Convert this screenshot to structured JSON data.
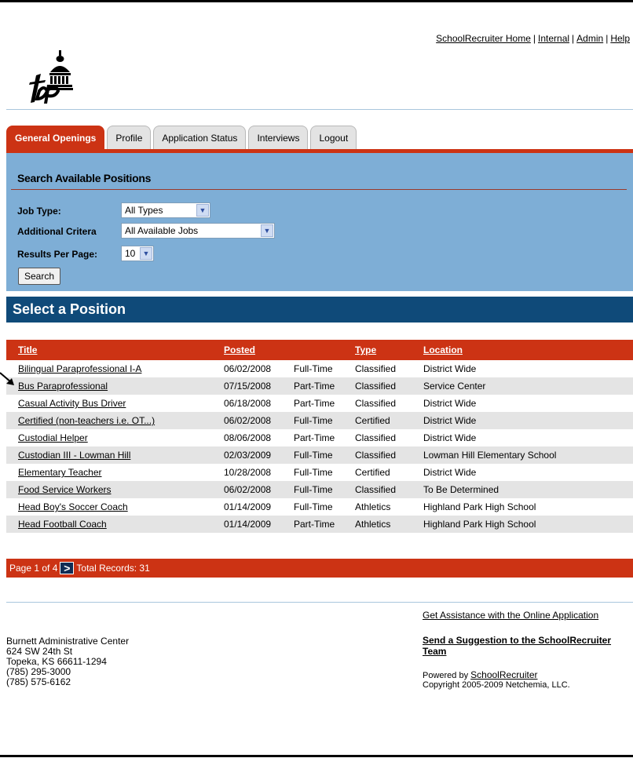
{
  "top_links": [
    "SchoolRecruiter Home",
    "Internal",
    "Admin",
    "Help"
  ],
  "tabs": [
    {
      "label": "General Openings",
      "active": true
    },
    {
      "label": "Profile",
      "active": false
    },
    {
      "label": "Application Status",
      "active": false
    },
    {
      "label": "Interviews",
      "active": false
    },
    {
      "label": "Logout",
      "active": false
    }
  ],
  "search": {
    "title": "Search Available Positions",
    "job_type_label": "Job Type:",
    "job_type_value": "All Types",
    "criteria_label": "Additional Critera",
    "criteria_value": "All Available Jobs",
    "per_page_label": "Results Per Page:",
    "per_page_value": "10",
    "button": "Search"
  },
  "select_title": "Select a Position",
  "table": {
    "headers": {
      "title": "Title",
      "posted": "Posted",
      "type": "Type",
      "location": "Location"
    },
    "rows": [
      {
        "title": "Bilingual Paraprofessional I-A",
        "posted": "06/02/2008",
        "hours": "Full-Time",
        "type": "Classified",
        "location": "District Wide"
      },
      {
        "title": "Bus Paraprofessional",
        "posted": "07/15/2008",
        "hours": "Part-Time",
        "type": "Classified",
        "location": "Service Center"
      },
      {
        "title": "Casual Activity Bus Driver",
        "posted": "06/18/2008",
        "hours": "Part-Time",
        "type": "Classified",
        "location": "District Wide"
      },
      {
        "title": "Certified (non-teachers i.e. OT...)",
        "posted": "06/02/2008",
        "hours": "Full-Time",
        "type": "Certified",
        "location": "District Wide"
      },
      {
        "title": "Custodial Helper",
        "posted": "08/06/2008",
        "hours": "Part-Time",
        "type": "Classified",
        "location": "District Wide"
      },
      {
        "title": "Custodian III - Lowman Hill",
        "posted": "02/03/2009",
        "hours": "Full-Time",
        "type": "Classified",
        "location": "Lowman Hill Elementary School"
      },
      {
        "title": "Elementary Teacher",
        "posted": "10/28/2008",
        "hours": "Full-Time",
        "type": "Certified",
        "location": "District Wide"
      },
      {
        "title": "Food Service Workers",
        "posted": "06/02/2008",
        "hours": "Full-Time",
        "type": "Classified",
        "location": "To Be Determined"
      },
      {
        "title": "Head Boy's Soccer Coach",
        "posted": "01/14/2009",
        "hours": "Full-Time",
        "type": "Athletics",
        "location": "Highland Park High School"
      },
      {
        "title": "Head Football Coach",
        "posted": "01/14/2009",
        "hours": "Part-Time",
        "type": "Athletics",
        "location": "Highland Park High School"
      }
    ]
  },
  "pager": {
    "page_text": "Page 1 of 4",
    "next_glyph": ">",
    "total_text": "Total Records: 31"
  },
  "footer": {
    "address": [
      "Burnett Administrative Center",
      "624 SW 24th St",
      "Topeka, KS 66611-1294",
      "(785) 295-3000",
      "(785) 575-6162"
    ],
    "assist_link": "Get Assistance with the Online Application",
    "suggest_link": "Send a Suggestion to the SchoolRecruiter Team",
    "powered_prefix": "Powered by",
    "powered_link": "SchoolRecruiter",
    "copyright": "Copyright 2005-2009 Netchemia, LLC."
  },
  "colors": {
    "accent_red": "#cc3314",
    "panel_blue": "#7eaed6",
    "header_navy": "#0f4a79"
  }
}
